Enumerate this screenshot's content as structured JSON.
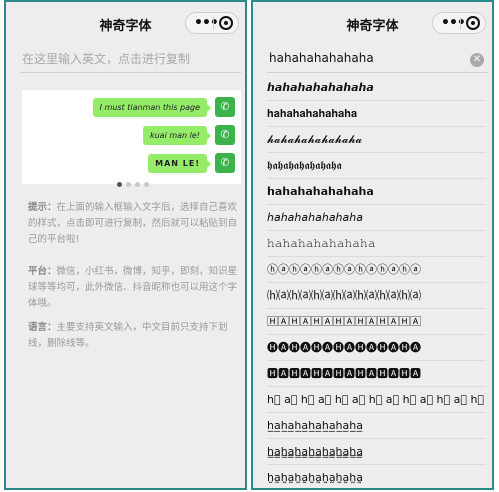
{
  "left": {
    "title": "神奇字体",
    "input_placeholder": "在这里输入英文，点击进行复制",
    "carousel": {
      "messages": [
        "I must tianman this page",
        "kuai man le!",
        "MAN LE!"
      ]
    },
    "tips": [
      {
        "label": "提示：",
        "text": "在上面的输入框输入文字后，选择自己喜欢的样式，点击即可进行复制，然后就可以粘贴到自己的平台啦!"
      },
      {
        "label": "平台：",
        "text": "微信，小红书，微博，知乎，即刻，知识星球等等均可，此外微信、抖音昵称也可以用这个字体哦。"
      },
      {
        "label": "语言：",
        "text": "主要支持英文输入，中文目前只支持下划线，删除线等。"
      }
    ]
  },
  "right": {
    "title": "神奇字体",
    "search_value": "hahahahahahaha",
    "fonts": [
      "𝙝𝙖𝙝𝙖𝙝𝙖𝙝𝙖𝙝𝙖𝙝𝙖𝙝𝙖",
      "𝐡𝐚𝐡𝐚𝐡𝐚𝐡𝐚𝐡𝐚𝐡𝐚𝐡𝐚",
      "𝓱𝓪𝓱𝓪𝓱𝓪𝓱𝓪𝓱𝓪𝓱𝓪𝓱𝓪",
      "𝖍𝖆𝖍𝖆𝖍𝖆𝖍𝖆𝖍𝖆𝖍𝖆𝖍𝖆",
      "𝗵𝗮𝗵𝗮𝗵𝗮𝗵𝗮𝗵𝗮𝗵𝗮𝗵𝗮",
      "𝘩𝘢𝘩𝘢𝘩𝘢𝘩𝘢𝘩𝘢𝘩𝘢𝘩𝘢",
      "𝚑𝚊𝚑𝚊𝚑𝚊𝚑𝚊𝚑𝚊𝚑𝚊𝚑𝚊",
      "ⓗⓐⓗⓐⓗⓐⓗⓐⓗⓐⓗⓐⓗⓐ",
      "⒣⒜⒣⒜⒣⒜⒣⒜⒣⒜⒣⒜⒣⒜",
      "🄷🄰🄷🄰🄷🄰🄷🄰🄷🄰🄷🄰🄷🄰",
      "🅗🅐🅗🅐🅗🅐🅗🅐🅗🅐🅗🅐🅗🅐",
      "🅷🅰🅷🅰🅷🅰🅷🅰🅷🅰🅷🅰🅷🅰",
      "h⃞ a⃞ h⃞ a⃞ h⃞ a⃞ h⃞ a⃞ h⃞ a⃞ h⃞ a⃞ h⃞ a⃞",
      "h̲a̲h̲a̲h̲a̲h̲a̲h̲a̲h̲a̲h̲a̲",
      "h̳a̳h̳a̳h̳a̳h̳a̳h̳a̳h̳a̳h̳a̳",
      "h̰a̰h̰a̰h̰a̰h̰a̰h̰a̰h̰a̰h̰a̰"
    ]
  }
}
